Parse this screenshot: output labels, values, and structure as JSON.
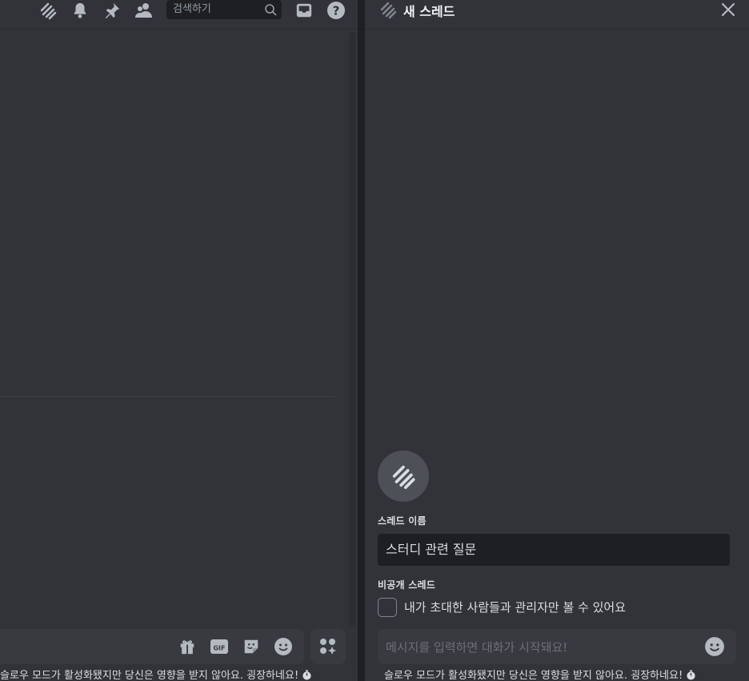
{
  "channel": {
    "search_placeholder": "검색하기",
    "slowmode_notice": "슬로우 모드가 활성화됐지만 당신은 영향을 받지 않아요. 굉장하네요!",
    "toolbar_icons": [
      "threads-icon",
      "bell-icon",
      "pin-icon",
      "members-icon",
      "inbox-icon",
      "help-icon"
    ],
    "composer_icons": [
      "gift-icon",
      "gif-icon",
      "sticker-icon",
      "emoji-icon",
      "apps-icon"
    ],
    "gif_label": "GIF"
  },
  "thread_panel": {
    "title": "새 스레드",
    "name_label": "스레드 이름",
    "name_value": "스터디 관련 질문",
    "private_label": "비공개 스레드",
    "private_description": "내가 초대한 사람들과 관리자만 볼 수 있어요",
    "private_checked": false,
    "message_placeholder": "메시지를 입력하면 대화가 시작돼요!",
    "slowmode_notice": "슬로우 모드가 활성화됐지만 당신은 영향을 받지 않아요. 굉장하네요!"
  },
  "colors": {
    "background": "#313338",
    "input_background": "#1e1f22",
    "composer_background": "#383a40",
    "icon": "#b5bac1"
  }
}
